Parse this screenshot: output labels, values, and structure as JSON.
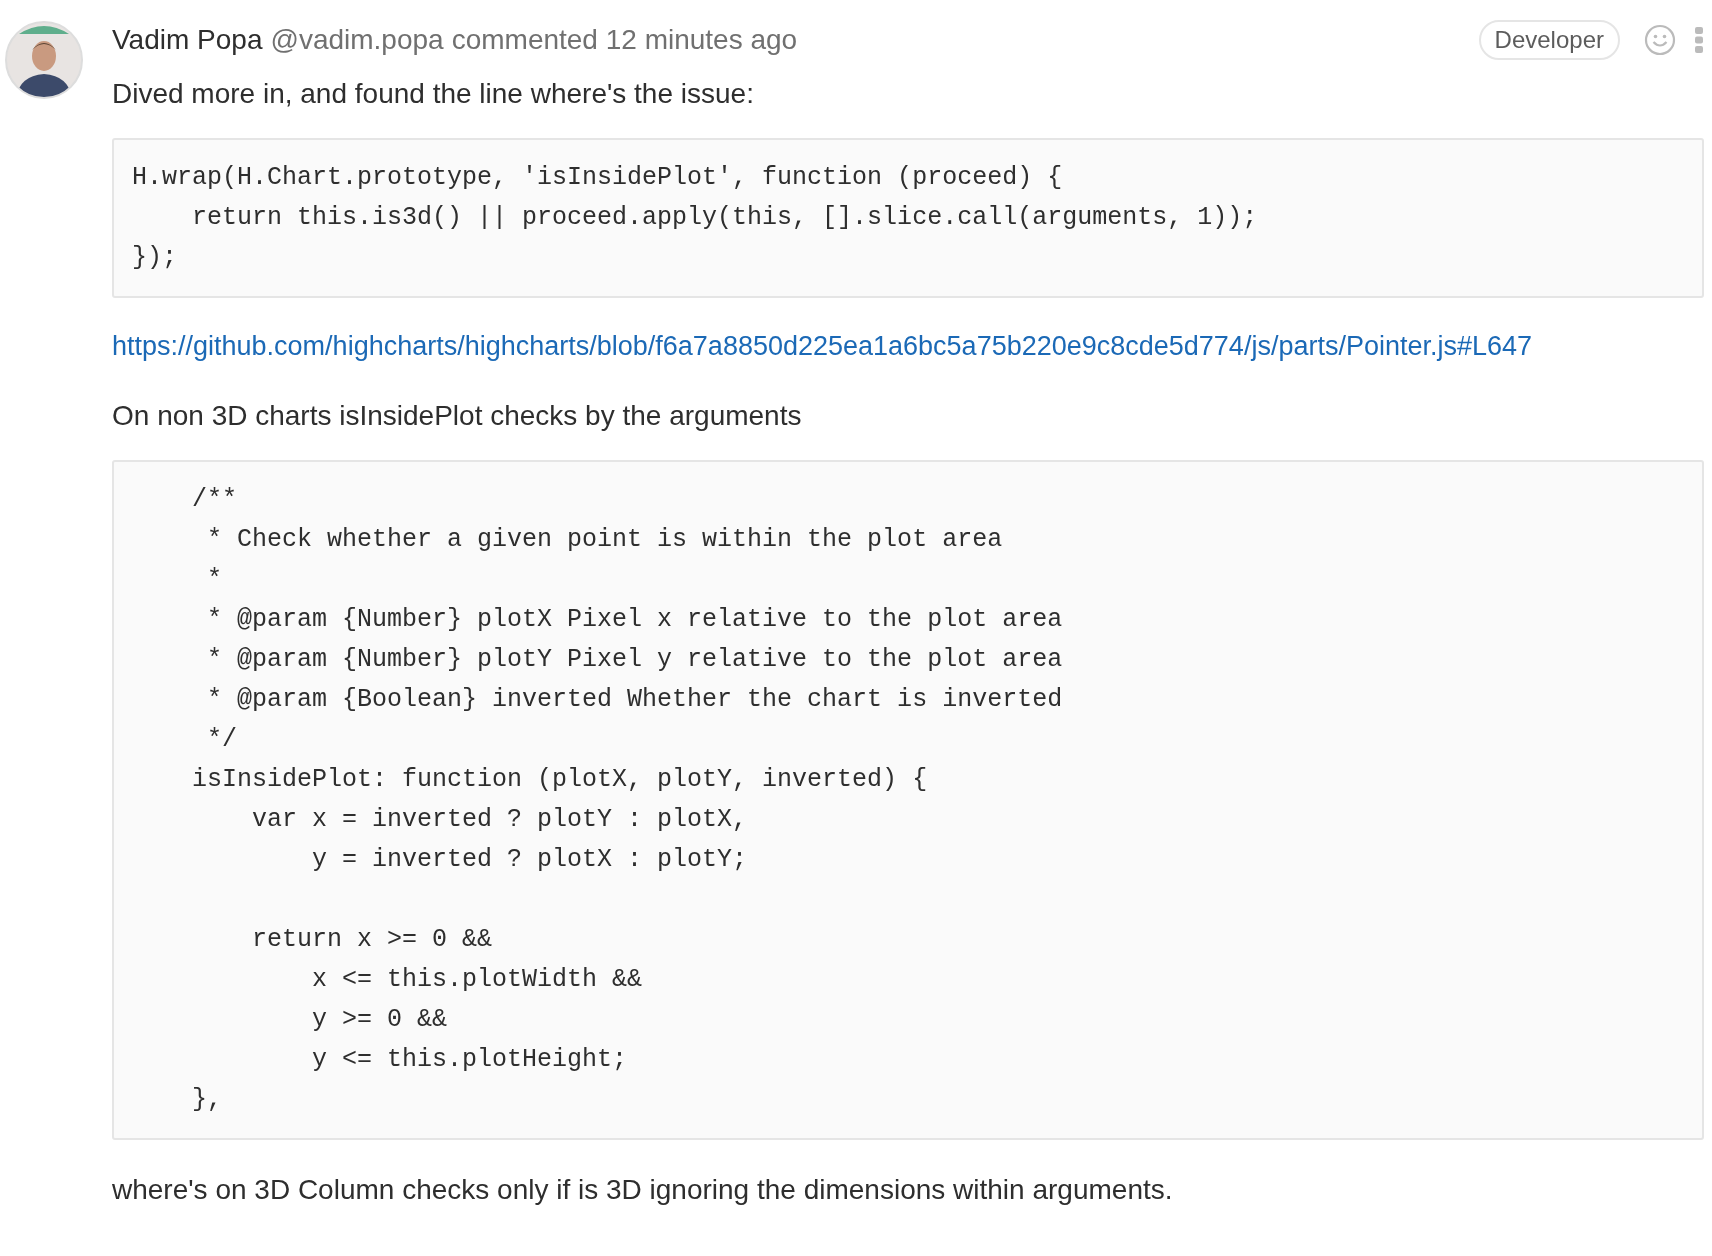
{
  "comment": {
    "author": "Vadim Popa",
    "handle": "@vadim.popa",
    "action": "commented 12 minutes ago",
    "role_badge": "Developer",
    "body": [
      {
        "kind": "text",
        "text": "Dived more in, and found the line where's the issue:"
      },
      {
        "kind": "code",
        "text": "H.wrap(H.Chart.prototype, 'isInsidePlot', function (proceed) {\n    return this.is3d() || proceed.apply(this, [].slice.call(arguments, 1));\n});"
      },
      {
        "kind": "link",
        "text": "https://github.com/highcharts/highcharts/blob/f6a7a8850d225ea1a6bc5a75b220e9c8cde5d774/js/parts/Pointer.js#L647"
      },
      {
        "kind": "text",
        "text": "On non 3D charts isInsidePlot checks by the arguments"
      },
      {
        "kind": "code",
        "text": "    /**\n     * Check whether a given point is within the plot area\n     *\n     * @param {Number} plotX Pixel x relative to the plot area\n     * @param {Number} plotY Pixel y relative to the plot area\n     * @param {Boolean} inverted Whether the chart is inverted\n     */\n    isInsidePlot: function (plotX, plotY, inverted) {\n        var x = inverted ? plotY : plotX,\n            y = inverted ? plotX : plotY;\n\n        return x >= 0 &&\n            x <= this.plotWidth &&\n            y >= 0 &&\n            y <= this.plotHeight;\n    },"
      },
      {
        "kind": "text",
        "text": "where's on 3D Column checks only if is 3D ignoring the dimensions within arguments."
      }
    ]
  }
}
